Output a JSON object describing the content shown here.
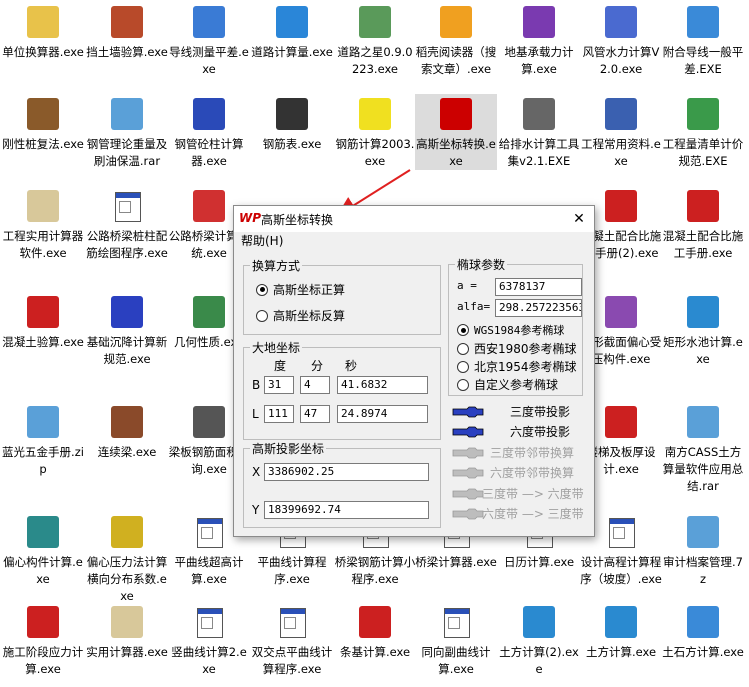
{
  "desktop_icons": [
    {
      "label": "单位换算器.exe",
      "icon": "folder-icon",
      "color": "#e8c24a"
    },
    {
      "label": "挡土墙验算.exe",
      "icon": "building-icon",
      "color": "#b84a2a"
    },
    {
      "label": "导线测量平差.exe",
      "icon": "computer-icon",
      "color": "#3a7bd5"
    },
    {
      "label": "道路计算量.exe",
      "icon": "doraemon-icon",
      "color": "#2a86d8"
    },
    {
      "label": "道路之星0.9.0223.exe",
      "icon": "setup-icon",
      "color": "#5a9a5a"
    },
    {
      "label": "稻壳阅读器（搜索文章）.exe",
      "icon": "reader-icon",
      "color": "#f0a020"
    },
    {
      "label": "地基承载力计算.exe",
      "icon": "monster-icon",
      "color": "#7a3ab0"
    },
    {
      "label": "风管水力计算V2.0.exe",
      "icon": "plane-icon",
      "color": "#4a6ad0"
    },
    {
      "label": "附合导线一般平差.EXE",
      "icon": "calculator-icon",
      "color": "#3a8ad8"
    },
    {
      "label": "刚性桩复法.exe",
      "icon": "chip-icon",
      "color": "#8a5a2a"
    },
    {
      "label": "钢管理论重量及刷油保温.rar",
      "icon": "archive-icon",
      "color": "#5aa0d8"
    },
    {
      "label": "钢管砼柱计算器.exe",
      "icon": "torch-icon",
      "color": "#2a4ab8"
    },
    {
      "label": "钢筋表.exe",
      "icon": "ink-icon",
      "color": "#333333"
    },
    {
      "label": "钢筋计算2003.exe",
      "icon": "l-icon",
      "color": "#f0e020"
    },
    {
      "label": "高斯坐标转换.exe",
      "icon": "wp-icon",
      "color": "#cc0000"
    },
    {
      "label": "给排水计算工具集v2.1.EXE",
      "icon": "satellite-icon",
      "color": "#666666"
    },
    {
      "label": "工程常用资料.exe",
      "icon": "book-icon",
      "color": "#3a60b0"
    },
    {
      "label": "工程量清单计价规范.EXE",
      "icon": "openbook-icon",
      "color": "#3a9a4a"
    },
    {
      "label": "工程实用计算器软件.exe",
      "icon": "shell-icon",
      "color": "#d8c89a"
    },
    {
      "label": "公路桥梁桩柱配筋绘图程序.exe",
      "icon": "window-icon",
      "color": "#2a50b8"
    },
    {
      "label": "公路桥梁计算系统.exe",
      "icon": "phone-icon",
      "color": "#d03030"
    },
    {
      "label": "混凝土配合比施工手册(2).exe",
      "icon": "pickaxe-icon",
      "color": "#cc2020"
    },
    {
      "label": "混凝土配合比施工手册.exe",
      "icon": "pickaxe-icon",
      "color": "#cc2020"
    },
    {
      "label": "混凝土验算.exe",
      "icon": "bicycle-icon",
      "color": "#cc2020"
    },
    {
      "label": "基础沉降计算新规范.exe",
      "icon": "figure-icon",
      "color": "#2a40c0"
    },
    {
      "label": "几何性质.exe",
      "icon": "tool-icon",
      "color": "#3a8a4a"
    },
    {
      "label": "矩形截面偏心受压构件.exe",
      "icon": "box-icon",
      "color": "#8a4ab0"
    },
    {
      "label": "矩形水池计算.exe",
      "icon": "globe-icon",
      "color": "#2a8ad0"
    },
    {
      "label": "蓝光五金手册.zip",
      "icon": "archive-icon",
      "color": "#5aa0d8"
    },
    {
      "label": "连续梁.exe",
      "icon": "bridge-icon",
      "color": "#8a4a2a"
    },
    {
      "label": "梁板钢筋面积查询.exe",
      "icon": "calendar-icon",
      "color": "#555555"
    },
    {
      "label": "楼梯及板厚设计.exe",
      "icon": "pickaxe-icon",
      "color": "#cc2020"
    },
    {
      "label": "南方CASS土方算量软件应用总结.rar",
      "icon": "archive-icon",
      "color": "#5aa0d8"
    },
    {
      "label": "偏心构件计算.exe",
      "icon": "compass-icon",
      "color": "#2a8a8a"
    },
    {
      "label": "偏心压力法计算横向分布系数.exe",
      "icon": "umbrella-icon",
      "color": "#d0b020"
    },
    {
      "label": "平曲线超高计算.exe",
      "icon": "window-icon",
      "color": "#2a50b8"
    },
    {
      "label": "平曲线计算程序.exe",
      "icon": "window-icon",
      "color": "#2a50b8"
    },
    {
      "label": "桥梁钢筋计算小程序.exe",
      "icon": "window-icon",
      "color": "#2a50b8"
    },
    {
      "label": "桥梁计算器.exe",
      "icon": "window-icon",
      "color": "#2a50b8"
    },
    {
      "label": "日历计算.exe",
      "icon": "window-icon",
      "color": "#2a50b8"
    },
    {
      "label": "设计高程计算程序（坡度）.exe",
      "icon": "window-icon",
      "color": "#2a50b8"
    },
    {
      "label": "审计档案管理.7z",
      "icon": "archive-icon",
      "color": "#5aa0d8"
    },
    {
      "label": "施工阶段应力计算.exe",
      "icon": "bicycle-icon",
      "color": "#cc2020"
    },
    {
      "label": "实用计算器.exe",
      "icon": "shell-icon",
      "color": "#d8c89a"
    },
    {
      "label": "竖曲线计算2.exe",
      "icon": "window-icon",
      "color": "#2a50b8"
    },
    {
      "label": "双交点平曲线计算程序.exe",
      "icon": "window-icon",
      "color": "#2a50b8"
    },
    {
      "label": "条基计算.exe",
      "icon": "tj-icon",
      "color": "#cc2020"
    },
    {
      "label": "同向副曲线计算.exe",
      "icon": "window-icon",
      "color": "#2a50b8"
    },
    {
      "label": "土方计算(2).exe",
      "icon": "globe-icon",
      "color": "#2a8ad0"
    },
    {
      "label": "土方计算.exe",
      "icon": "globe-icon",
      "color": "#2a8ad0"
    },
    {
      "label": "土石方计算.exe",
      "icon": "pickaxe-icon",
      "color": "#3a8ad8"
    }
  ],
  "dialog": {
    "title": "高斯坐标转换",
    "close": "✕",
    "menu_help": "帮助(H)",
    "calc_mode": {
      "title": "换算方式",
      "opt_forward": "高斯坐标正算",
      "opt_inverse": "高斯坐标反算",
      "selected": "forward"
    },
    "geo": {
      "title": "大地坐标",
      "h_deg": "度",
      "h_min": "分",
      "h_sec": "秒",
      "b_label": "B",
      "b_deg": "31",
      "b_min": "4",
      "b_sec": "41.6832",
      "l_label": "L",
      "l_deg": "111",
      "l_min": "47",
      "l_sec": "24.8974"
    },
    "proj": {
      "title": "高斯投影坐标",
      "x_label": "X",
      "x_value": "3386902.25",
      "y_label": "Y",
      "y_value": "18399692.74"
    },
    "ellipsoid": {
      "title": "椭球参数",
      "a_label": "a  =",
      "a_value": "6378137",
      "alfa_label": "alfa=",
      "alfa_value": "298.2572235635",
      "opt_wgs": "WGS1984参考椭球",
      "opt_xian": "西安1980参考椭球",
      "opt_beijing": "北京1954参考椭球",
      "opt_custom": "自定义参考椭球",
      "selected": "wgs"
    },
    "actions": {
      "three_deg": "三度带投影",
      "six_deg": "六度带投影",
      "three_adj": "三度带邻带换算",
      "six_adj": "六度带邻带换算",
      "three_to_six": "三度带 —> 六度带",
      "six_to_three": "六度带 —> 三度带"
    }
  },
  "colors": {
    "arrow": "#e02020",
    "selection": "#dcdcdc"
  }
}
